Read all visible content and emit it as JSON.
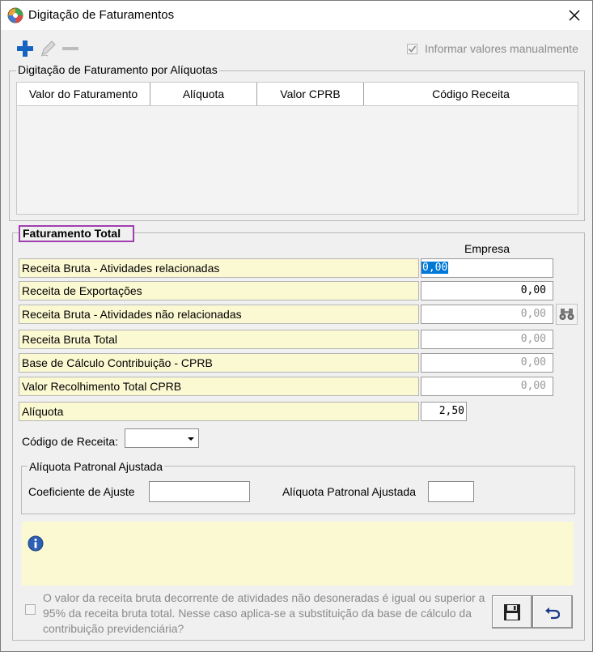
{
  "window": {
    "title": "Digitação de Faturamentos"
  },
  "toolbar": {
    "manual_values_label": "Informar valores manualmente"
  },
  "aliquotas_group": {
    "legend": "Digitação de Faturamento por Alíquotas",
    "columns": [
      "Valor do Faturamento",
      "Alíquota",
      "Valor CPRB",
      "Código Receita"
    ]
  },
  "faturamento_total": {
    "legend": "Faturamento Total",
    "column_header": "Empresa",
    "rows": [
      {
        "label": "Receita Bruta - Atividades relacionadas",
        "value": "0,00"
      },
      {
        "label": "Receita de Exportações",
        "value": "0,00"
      },
      {
        "label": "Receita Bruta - Atividades não relacionadas",
        "value": "0,00"
      },
      {
        "label": "Receita Bruta Total",
        "value": "0,00"
      },
      {
        "label": "Base de Cálculo Contribuição - CPRB",
        "value": "0,00"
      },
      {
        "label": "Valor Recolhimento Total CPRB",
        "value": "0,00"
      },
      {
        "label": "Alíquota",
        "value": "2,50"
      }
    ],
    "codigo_receita_label": "Código de Receita:",
    "codigo_receita_value": ""
  },
  "patronal_group": {
    "legend": "Alíquota Patronal Ajustada",
    "coef_label": "Coeficiente de Ajuste",
    "coef_value": "",
    "aliquota_label": "Alíquota Patronal Ajustada",
    "aliquota_value": ""
  },
  "footer": {
    "text": "O valor da receita bruta decorrente de atividades não desoneradas é igual ou superior a 95% da receita bruta total. Nesse caso aplica-se a substituição da base de cálculo da contribuição previdenciária?"
  },
  "colors": {
    "accent_blue": "#1565c0",
    "highlight_purple": "#9f3fb0",
    "field_yellow": "#fbf9d2"
  }
}
